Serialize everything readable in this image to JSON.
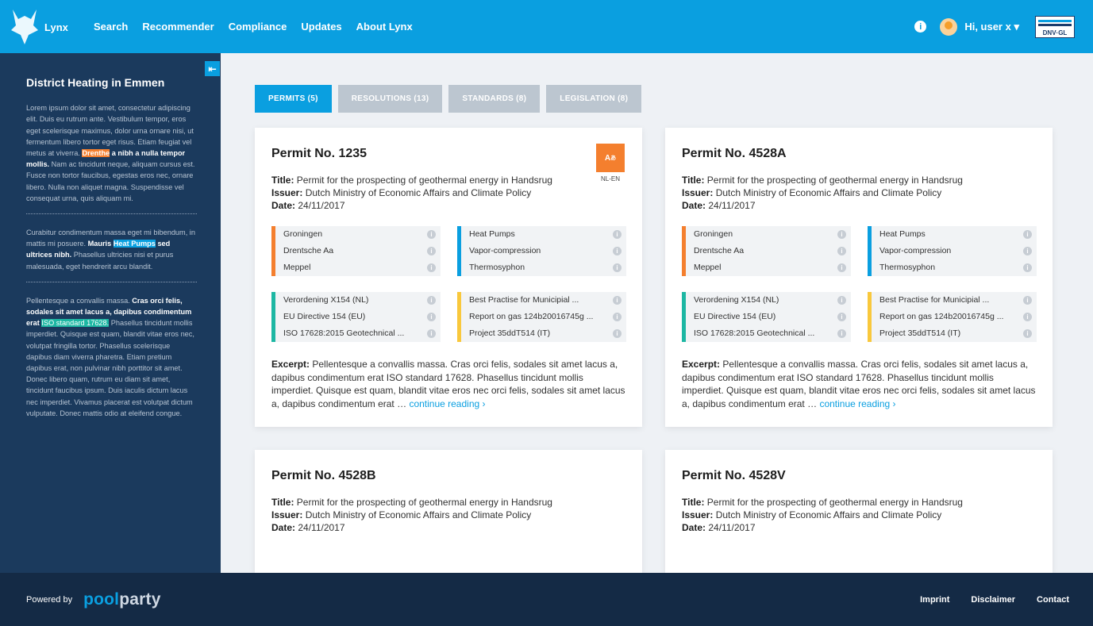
{
  "header": {
    "logo_text": "Lynx",
    "nav": [
      "Search",
      "Recommender",
      "Compliance",
      "Updates",
      "About Lynx"
    ],
    "info_icon": "info-icon",
    "user_label": "Hi, user x",
    "user_caret": "▾",
    "brand_label": "DNV·GL",
    "colors": {
      "accent": "#0a9fe0",
      "sidebar": "#1b3a5d",
      "footer": "#142a45"
    }
  },
  "sidebar": {
    "collapse_icon": "collapse-left-icon",
    "title": "District Heating in Emmen",
    "p1_a": "Lorem ipsum dolor sit amet, consectetur adipiscing elit. Duis eu rutrum ante. Vestibulum tempor, eros eget scelerisque maximus, dolor urna ornare nisi, ut fermentum libero tortor eget risus. Etiam feugiat vel metus at viverra. ",
    "p1_hl": "Drenthe",
    "p1_b": " a nibh a nulla tempor mollis.",
    "p1_c": " Nam ac tincidunt neque, aliquam cursus est. Fusce non tortor faucibus, egestas eros nec, ornare libero. Nulla non aliquet magna. Suspendisse vel consequat urna, quis aliquam mi.",
    "p2_a": "Curabitur condimentum massa eget mi bibendum, in mattis mi posuere. ",
    "p2_b1": "Mauris ",
    "p2_hl": "Heat Pumps",
    "p2_b2": " sed ultrices nibh.",
    "p2_c": " Phasellus ultricies nisi et purus malesuada, eget hendrerit arcu blandit.",
    "p3_a": "Pellentesque a convallis massa. ",
    "p3_b": "Cras orci felis, sodales sit amet lacus a, dapibus condimentum erat ",
    "p3_hl": "ISO standard 17628.",
    "p3_c": " Phasellus tincidunt mollis imperdiet. Quisque est quam, blandit vitae eros nec, volutpat fringilla tortor. Phasellus scelerisque dapibus diam viverra pharetra. Etiam pretium dapibus erat, non pulvinar nibh porttitor sit amet. Donec libero quam, rutrum eu diam sit amet, tincidunt faucibus ipsum. Duis iaculis dictum lacus nec imperdiet. Vivamus placerat est volutpat dictum vulputate. Donec mattis odio at eleifend congue."
  },
  "tabs": [
    {
      "label": "PERMITS (5)",
      "active": true
    },
    {
      "label": "RESOLUTIONS (13)",
      "active": false
    },
    {
      "label": "STANDARDS (8)",
      "active": false
    },
    {
      "label": "LEGISLATION (8)",
      "active": false
    }
  ],
  "labels": {
    "title": "Title:",
    "issuer": "Issuer:",
    "date": "Date:",
    "excerpt": "Excerpt:",
    "continue": "continue reading ›"
  },
  "cards": [
    {
      "heading": "Permit No. 1235",
      "title": "Permit for the prospecting of geothermal energy in Handsrug",
      "issuer": "Dutch Ministry of Economic Affairs and Climate Policy",
      "date": "24/11/2017",
      "translate_label": "NL-EN",
      "tags": {
        "places": [
          "Groningen",
          "Drentsche Aa",
          "Meppel"
        ],
        "topics": [
          "Heat Pumps",
          "Vapor-compression",
          "Thermosyphon"
        ],
        "laws": [
          "Verordening X154 (NL)",
          "EU Directive 154 (EU)",
          "ISO 17628:2015 Geotechnical ..."
        ],
        "docs": [
          "Best Practise for Municipial ...",
          "Report on gas 124b20016745g ...",
          "Project 35ddT514 (IT)"
        ]
      },
      "excerpt": "Pellentesque a convallis massa. Cras orci felis, sodales sit amet lacus a, dapibus condimentum erat ISO standard 17628. Phasellus tincidunt mollis imperdiet. Quisque est quam, blandit vitae eros nec orci felis, sodales sit amet lacus a, dapibus condimentum erat … "
    },
    {
      "heading": "Permit No. 4528A",
      "title": "Permit for the prospecting of geothermal energy in Handsrug",
      "issuer": "Dutch Ministry of Economic Affairs and Climate Policy",
      "date": "24/11/2017",
      "tags": {
        "places": [
          "Groningen",
          "Drentsche Aa",
          "Meppel"
        ],
        "topics": [
          "Heat Pumps",
          "Vapor-compression",
          "Thermosyphon"
        ],
        "laws": [
          "Verordening X154 (NL)",
          "EU Directive 154 (EU)",
          "ISO 17628:2015 Geotechnical ..."
        ],
        "docs": [
          "Best Practise for Municipial ...",
          "Report on gas 124b20016745g ...",
          "Project 35ddT514 (IT)"
        ]
      },
      "excerpt": "Pellentesque a convallis massa. Cras orci felis, sodales sit amet lacus a, dapibus condimentum erat ISO standard 17628. Phasellus tincidunt mollis imperdiet. Quisque est quam, blandit vitae eros nec orci felis, sodales sit amet lacus a, dapibus condimentum erat … "
    },
    {
      "heading": "Permit No. 4528B",
      "title": "Permit for the prospecting of geothermal energy in Handsrug",
      "issuer": "Dutch Ministry of Economic Affairs and Climate Policy",
      "date": "24/11/2017"
    },
    {
      "heading": "Permit No. 4528V",
      "title": "Permit for the prospecting of geothermal energy in Handsrug",
      "issuer": "Dutch Ministry of Economic Affairs and Climate Policy",
      "date": "24/11/2017"
    }
  ],
  "tag_colors": {
    "places": "#f47f2e",
    "topics": "#0a9fe0",
    "laws": "#1db7a3",
    "docs": "#f9c83c"
  },
  "footer": {
    "powered_by": "Powered by",
    "brand_a": "pool",
    "brand_b": "party",
    "links": [
      "Imprint",
      "Disclaimer",
      "Contact"
    ]
  }
}
